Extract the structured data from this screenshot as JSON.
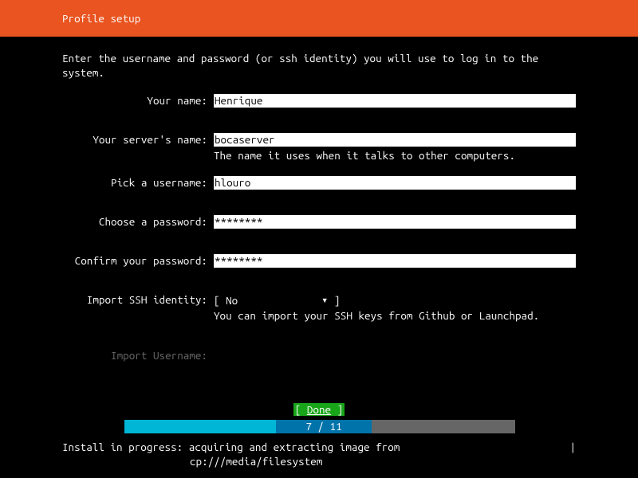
{
  "header": {
    "title": "Profile setup"
  },
  "intro": "Enter the username and password (or ssh identity) you will use to log in to the system.",
  "fields": {
    "name": {
      "label": "Your name:",
      "value": "Henrique"
    },
    "server": {
      "label": "Your server's name:",
      "value": "bocaserver",
      "hint": "The name it uses when it talks to other computers."
    },
    "username": {
      "label": "Pick a username:",
      "value": "hlouro"
    },
    "password": {
      "label": "Choose a password:",
      "value": "********"
    },
    "confirm": {
      "label": "Confirm your password:",
      "value": "********"
    },
    "ssh": {
      "label": "Import SSH identity:",
      "value": "No",
      "hint": "You can import your SSH keys from Github or Launchpad."
    },
    "import_user": {
      "label": "Import Username:"
    }
  },
  "done": {
    "open": "[ ",
    "label": "Done",
    "close": "      ]"
  },
  "progress": {
    "text": "7 / 11"
  },
  "status": {
    "line1": "Install in progress: acquiring and extracting image from",
    "line2": "cp:///media/filesystem",
    "spinner": "|"
  }
}
